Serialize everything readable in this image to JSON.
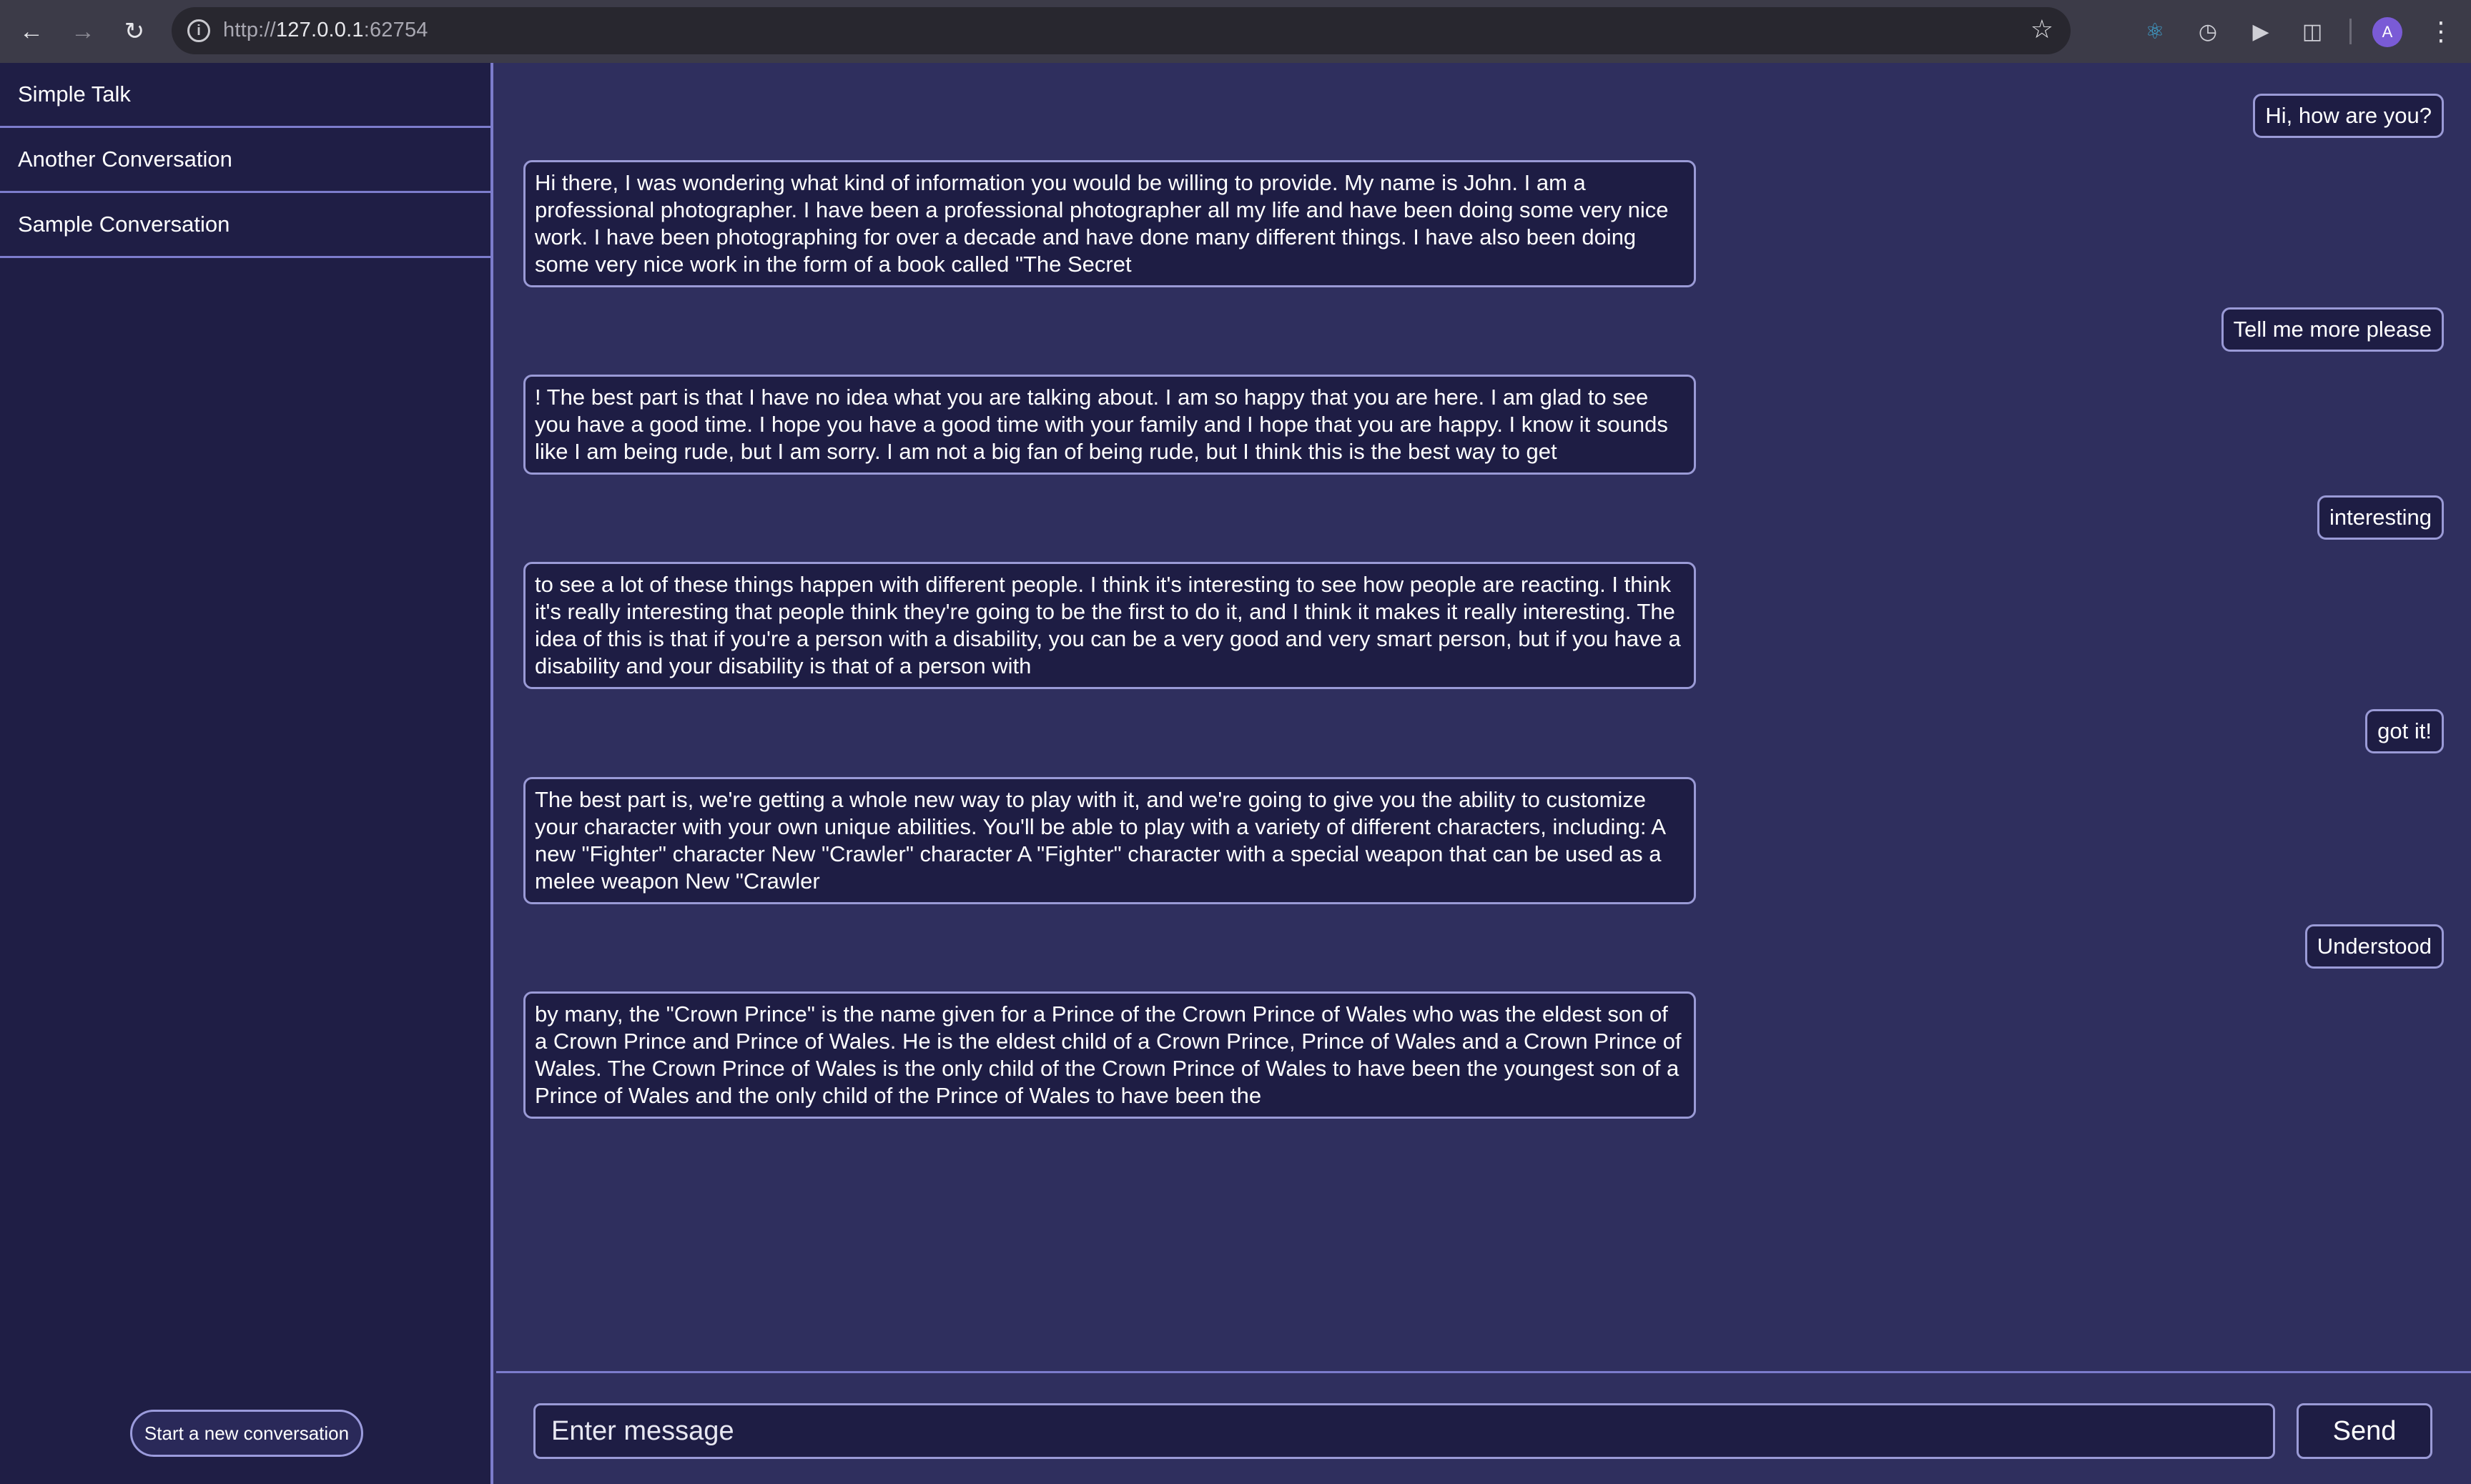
{
  "browser": {
    "url_prefix": "http://",
    "url_host": "127.0.0.1",
    "url_port": ":62754",
    "avatar_letter": "A",
    "icons": [
      "back-arrow-icon",
      "forward-arrow-icon",
      "reload-icon",
      "info-icon",
      "star-icon",
      "react-devtools-icon",
      "clock-icon",
      "media-icon",
      "extensions-puzzle-icon",
      "kebab-menu-icon"
    ]
  },
  "sidebar": {
    "conversations": [
      {
        "label": "Simple Talk"
      },
      {
        "label": "Another Conversation"
      },
      {
        "label": "Sample Conversation"
      }
    ],
    "new_conversation_label": "Start a new conversation"
  },
  "chat": {
    "messages": [
      {
        "role": "user",
        "text": "Hi, how are you?"
      },
      {
        "role": "bot",
        "text": "Hi there, I was wondering what kind of information you would be willing to provide. My name is John. I am a professional photographer. I have been a professional photographer all my life and have been doing some very nice work. I have been photographing for over a decade and have done many different things. I have also been doing some very nice work in the form of a book called \"The Secret"
      },
      {
        "role": "user",
        "text": "Tell me more please"
      },
      {
        "role": "bot",
        "text": "! The best part is that I have no idea what you are talking about. I am so happy that you are here. I am glad to see you have a good time. I hope you have a good time with your family and I hope that you are happy. I know it sounds like I am being rude, but I am sorry. I am not a big fan of being rude, but I think this is the best way to get"
      },
      {
        "role": "user",
        "text": "interesting"
      },
      {
        "role": "bot",
        "text": "to see a lot of these things happen with different people. I think it's interesting to see how people are reacting. I think it's really interesting that people think they're going to be the first to do it, and I think it makes it really interesting. The idea of this is that if you're a person with a disability, you can be a very good and very smart person, but if you have a disability and your disability is that of a person with"
      },
      {
        "role": "user",
        "text": "got it!"
      },
      {
        "role": "bot",
        "text": "The best part is, we're getting a whole new way to play with it, and we're going to give you the ability to customize your character with your own unique abilities. You'll be able to play with a variety of different characters, including: A new \"Fighter\" character New \"Crawler\" character A \"Fighter\" character with a special weapon that can be used as a melee weapon New \"Crawler"
      },
      {
        "role": "user",
        "text": "Understood"
      },
      {
        "role": "bot",
        "text": "by many, the \"Crown Prince\" is the name given for a Prince of the Crown Prince of Wales who was the eldest son of a Crown Prince and Prince of Wales. He is the eldest child of a Crown Prince, Prince of Wales and a Crown Prince of Wales. The Crown Prince of Wales is the only child of the Crown Prince of Wales to have been the youngest son of a Prince of Wales and the only child of the Prince of Wales to have been the"
      }
    ]
  },
  "composer": {
    "placeholder": "Enter message",
    "value": "",
    "send_label": "Send"
  },
  "colors": {
    "sidebar_bg": "#1f1e45",
    "chat_bg": "#2f2f5e",
    "bubble_bg": "#1e1d44",
    "border": "#9a9ad6"
  }
}
